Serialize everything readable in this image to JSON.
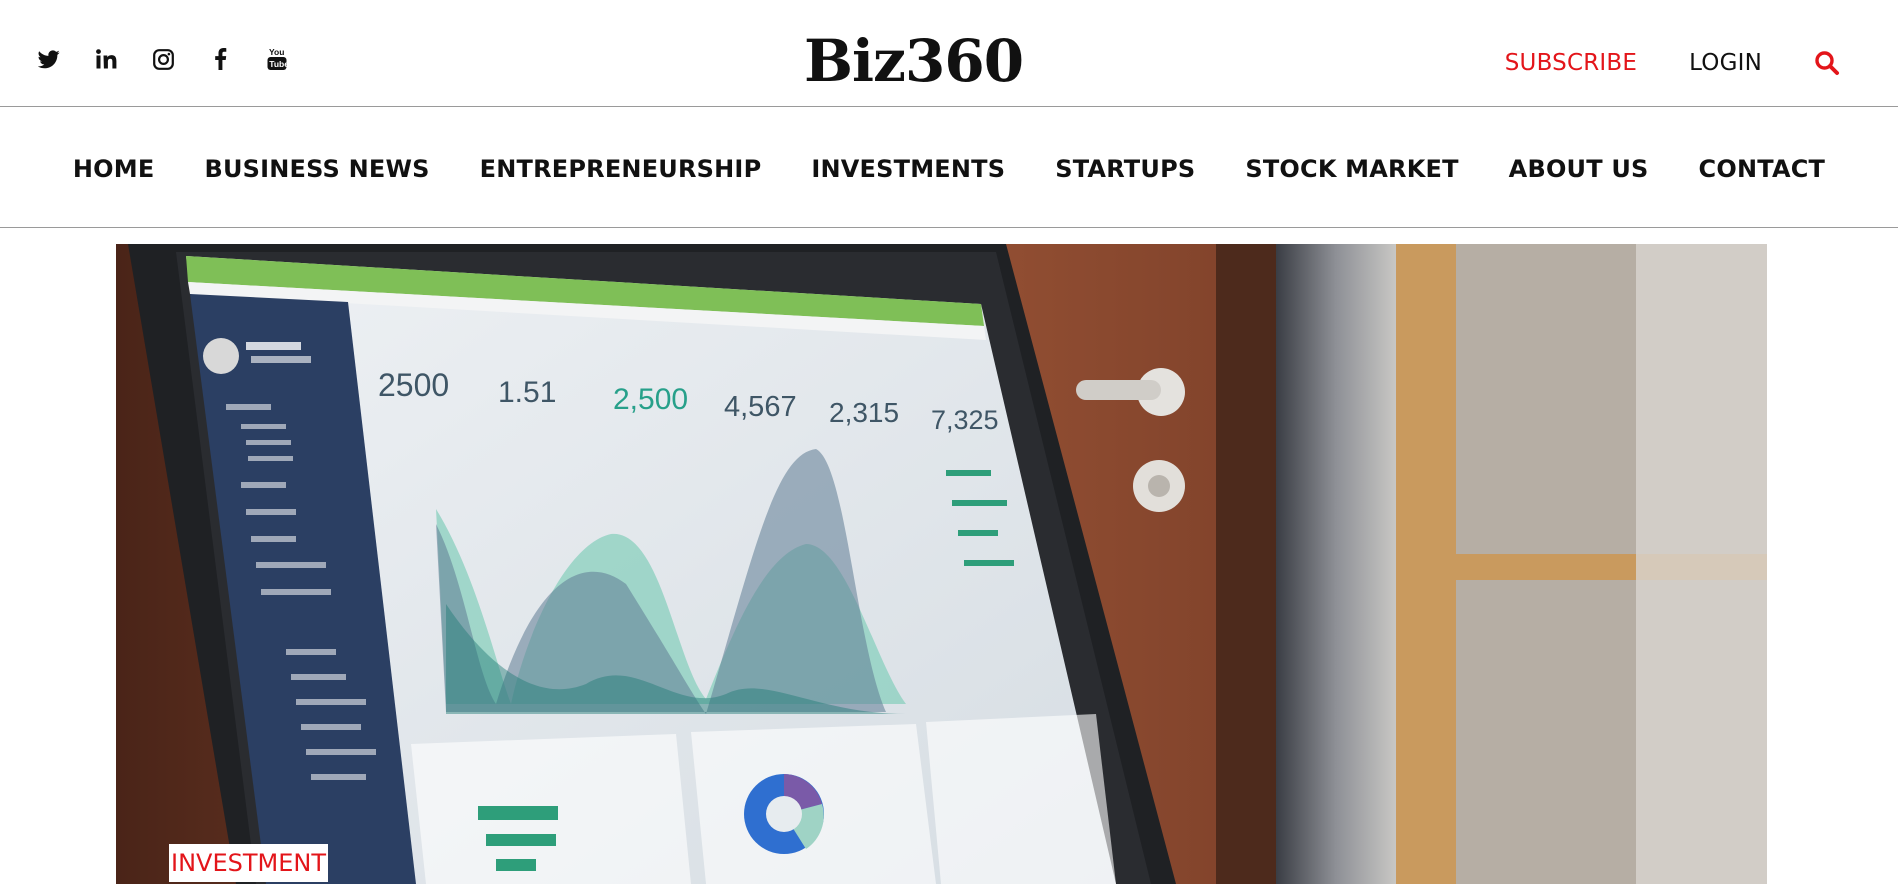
{
  "social": [
    {
      "icon": "twitter-icon"
    },
    {
      "icon": "linkedin-icon"
    },
    {
      "icon": "instagram-icon"
    },
    {
      "icon": "facebook-icon"
    },
    {
      "icon": "youtube-icon"
    }
  ],
  "brand": {
    "name": "Biz360"
  },
  "header": {
    "subscribe_label": "SUBSCRIBE",
    "login_label": "LOGIN",
    "search_icon": "search-icon"
  },
  "nav": {
    "items": [
      {
        "label": "HOME"
      },
      {
        "label": "BUSINESS NEWS"
      },
      {
        "label": "ENTREPRENEURSHIP"
      },
      {
        "label": "INVESTMENTS"
      },
      {
        "label": "STARTUPS"
      },
      {
        "label": "STOCK MARKET"
      },
      {
        "label": "ABOUT US"
      },
      {
        "label": "CONTACT"
      }
    ]
  },
  "hero": {
    "category_label": "INVESTMENT",
    "screen_stats": [
      {
        "value": "2500"
      },
      {
        "value": "1.51"
      },
      {
        "value": "2,500"
      },
      {
        "value": "4,567"
      },
      {
        "value": "2,315"
      },
      {
        "value": "7,325"
      }
    ]
  },
  "colors": {
    "accent": "#e3151a",
    "text": "#111111",
    "divider": "#9a9a9a"
  }
}
